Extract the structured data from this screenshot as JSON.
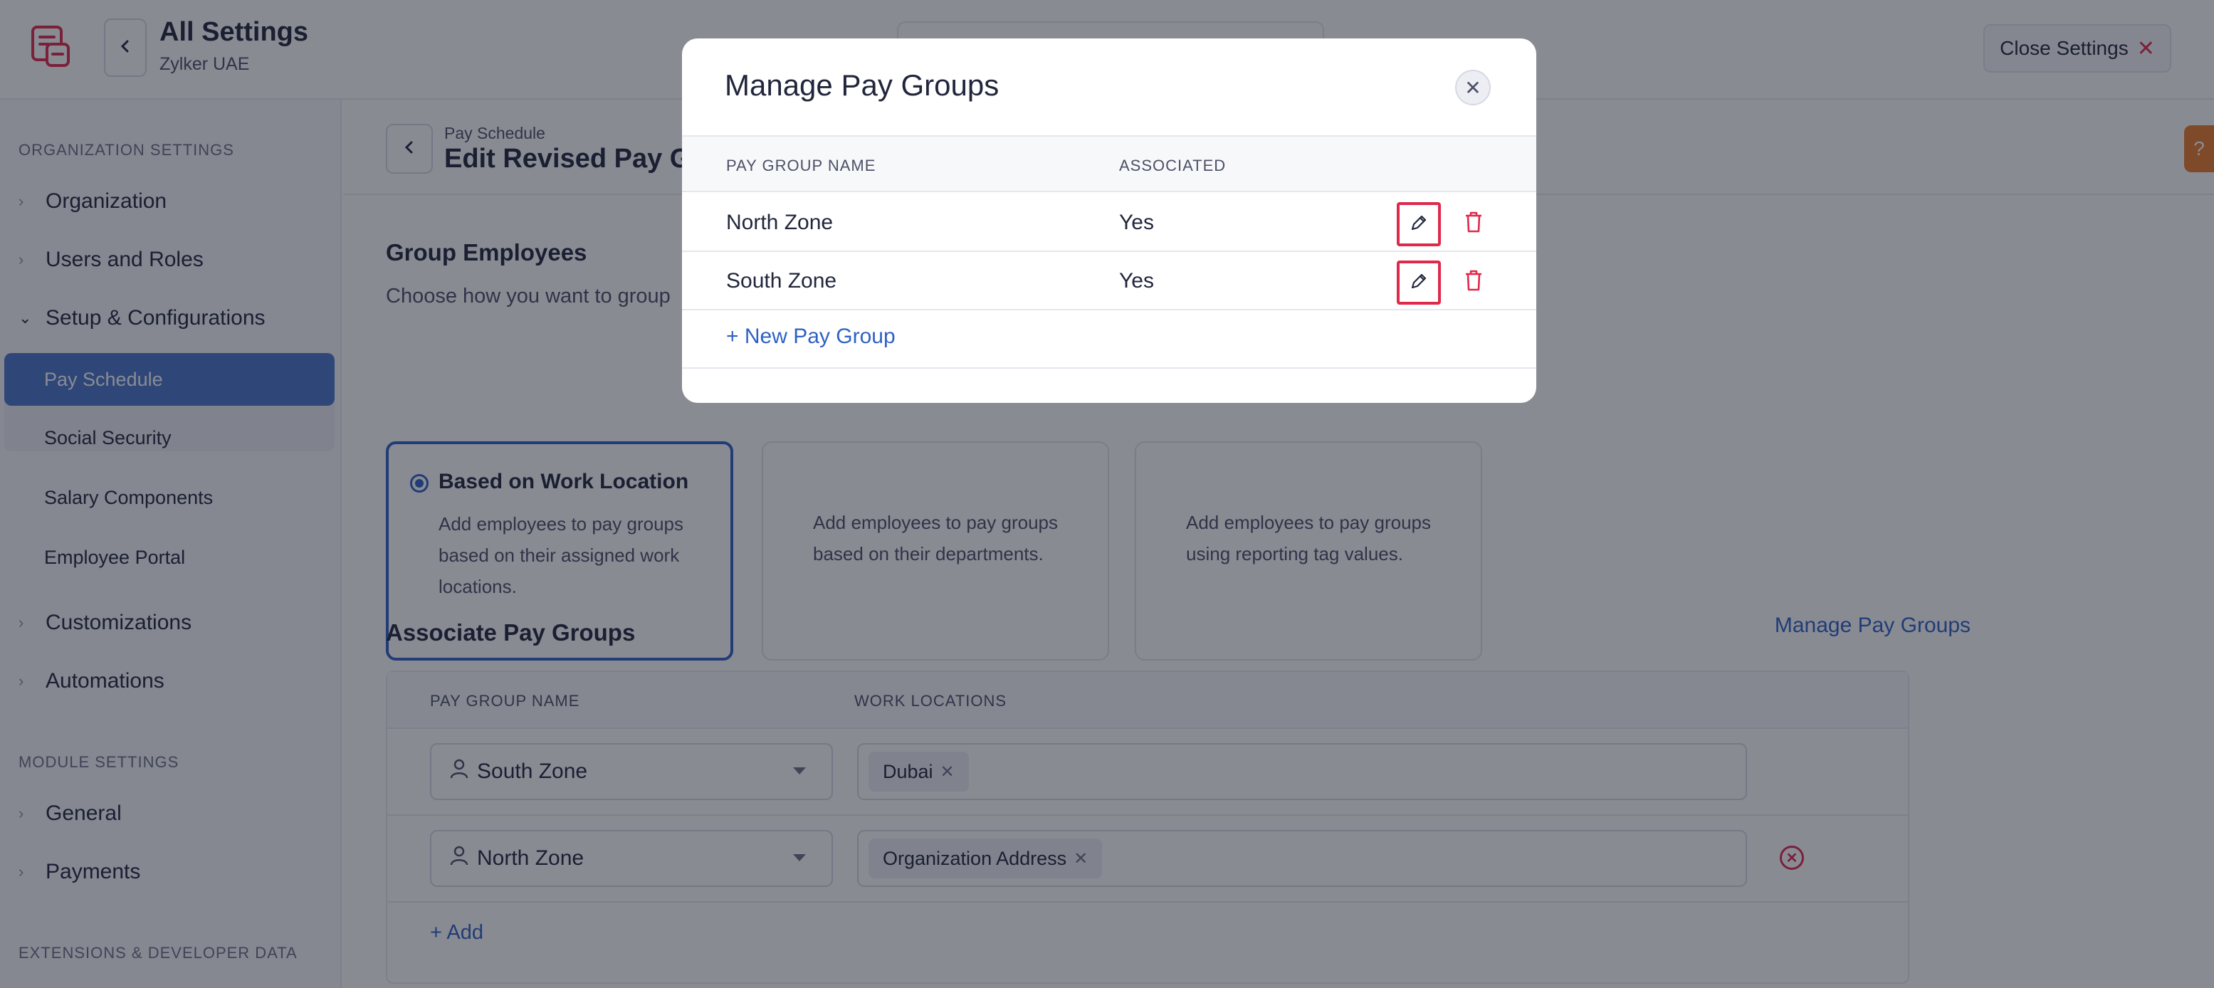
{
  "header": {
    "title": "All Settings",
    "subtitle": "Zylker UAE",
    "close_label": "Close Settings",
    "close_icon": "close-icon"
  },
  "sidebar": {
    "org_section": "ORGANIZATION SETTINGS",
    "items": [
      {
        "label": "Organization"
      },
      {
        "label": "Users and Roles"
      },
      {
        "label": "Setup & Configurations"
      },
      {
        "label": "Customizations"
      },
      {
        "label": "Automations"
      }
    ],
    "sub_items": [
      {
        "label": "Pay Schedule"
      },
      {
        "label": "Social Security"
      },
      {
        "label": "Salary Components"
      },
      {
        "label": "Employee Portal"
      }
    ],
    "module_section": "MODULE SETTINGS",
    "module_items": [
      {
        "label": "General"
      },
      {
        "label": "Payments"
      }
    ],
    "ext_section": "EXTENSIONS & DEVELOPER DATA"
  },
  "main": {
    "breadcrumb": "Pay Schedule",
    "title": "Edit Revised Pay Gr",
    "group_heading": "Group Employees",
    "group_desc": "Choose how you want to group",
    "cards": [
      {
        "title": "Based on Work Location",
        "desc": "Add employees to pay groups based on their assigned work locations."
      },
      {
        "title": "",
        "desc": "Add employees to pay groups based on their departments."
      },
      {
        "title": "",
        "desc": "Add employees to pay groups using reporting tag values."
      }
    ],
    "assoc_heading": "Associate Pay Groups",
    "manage_link": "Manage Pay Groups",
    "table_headers": [
      "PAY GROUP NAME",
      "WORK LOCATIONS"
    ],
    "rows": [
      {
        "group": "South Zone",
        "location": "Dubai"
      },
      {
        "group": "North Zone",
        "location": "Organization Address"
      }
    ],
    "add_label": "+ Add"
  },
  "modal": {
    "title": "Manage Pay Groups",
    "headers": [
      "PAY GROUP NAME",
      "ASSOCIATED"
    ],
    "rows": [
      {
        "name": "North Zone",
        "associated": "Yes"
      },
      {
        "name": "South Zone",
        "associated": "Yes"
      }
    ],
    "new_label": "New Pay Group",
    "accent_color": "#2f61c4",
    "danger_color": "#e0284b"
  }
}
